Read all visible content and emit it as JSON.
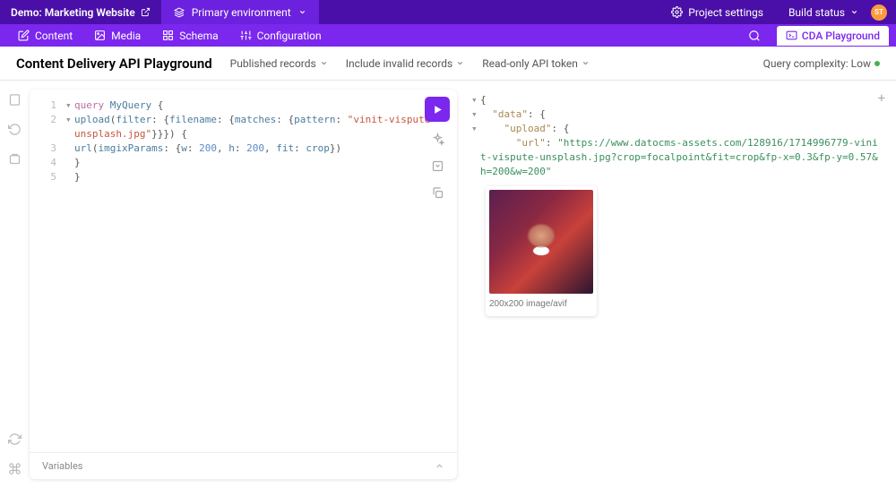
{
  "topbar": {
    "brand": "Demo: Marketing Website",
    "env_label": "Primary environment",
    "project_settings": "Project settings",
    "build_status": "Build status",
    "avatar_initials": "ST"
  },
  "navbar": {
    "content": "Content",
    "media": "Media",
    "schema": "Schema",
    "configuration": "Configuration",
    "cda_playground": "CDA Playground"
  },
  "header": {
    "title": "Content Delivery API Playground",
    "published_records": "Published records",
    "include_invalid": "Include invalid records",
    "readonly_token": "Read-only API token",
    "complexity_label": "Query complexity: Low"
  },
  "query": {
    "lines": [
      {
        "n": "1",
        "fold": "▾",
        "tokens": [
          {
            "c": "tok-kw",
            "t": "query"
          },
          {
            "c": "",
            "t": " "
          },
          {
            "c": "tok-name",
            "t": "MyQuery"
          },
          {
            "c": "",
            "t": " "
          },
          {
            "c": "tok-paren",
            "t": "{"
          }
        ]
      },
      {
        "n": "2",
        "fold": "▾",
        "indent": "  ",
        "tokens": [
          {
            "c": "tok-name",
            "t": "upload"
          },
          {
            "c": "tok-paren",
            "t": "("
          },
          {
            "c": "tok-attr",
            "t": "filter"
          },
          {
            "c": "tok-paren",
            "t": ": {"
          },
          {
            "c": "tok-attr",
            "t": "filename"
          },
          {
            "c": "tok-paren",
            "t": ": {"
          },
          {
            "c": "tok-attr",
            "t": "matches"
          },
          {
            "c": "tok-paren",
            "t": ": {"
          },
          {
            "c": "tok-attr",
            "t": "pattern"
          },
          {
            "c": "tok-paren",
            "t": ": "
          },
          {
            "c": "tok-str",
            "t": "\"vinit-vispute-unsplash.jpg\""
          },
          {
            "c": "tok-paren",
            "t": "}}}) {"
          }
        ]
      },
      {
        "n": "3",
        "fold": "",
        "indent": "    ",
        "tokens": [
          {
            "c": "tok-name",
            "t": "url"
          },
          {
            "c": "tok-paren",
            "t": "("
          },
          {
            "c": "tok-attr",
            "t": "imgixParams"
          },
          {
            "c": "tok-paren",
            "t": ": {"
          },
          {
            "c": "tok-attr",
            "t": "w"
          },
          {
            "c": "tok-paren",
            "t": ": "
          },
          {
            "c": "tok-num",
            "t": "200"
          },
          {
            "c": "tok-paren",
            "t": ", "
          },
          {
            "c": "tok-attr",
            "t": "h"
          },
          {
            "c": "tok-paren",
            "t": ": "
          },
          {
            "c": "tok-num",
            "t": "200"
          },
          {
            "c": "tok-paren",
            "t": ", "
          },
          {
            "c": "tok-attr",
            "t": "fit"
          },
          {
            "c": "tok-paren",
            "t": ": "
          },
          {
            "c": "tok-name",
            "t": "crop"
          },
          {
            "c": "tok-paren",
            "t": "})"
          }
        ]
      },
      {
        "n": "4",
        "fold": "",
        "indent": "  ",
        "tokens": [
          {
            "c": "tok-paren",
            "t": "}"
          }
        ]
      },
      {
        "n": "5",
        "fold": "",
        "tokens": [
          {
            "c": "tok-paren",
            "t": "}"
          }
        ]
      }
    ],
    "variables_label": "Variables"
  },
  "result": {
    "lines": [
      {
        "fold": "▾",
        "indent": "",
        "tokens": [
          {
            "c": "jp",
            "t": "{"
          }
        ]
      },
      {
        "fold": "▾",
        "indent": "  ",
        "tokens": [
          {
            "c": "jk",
            "t": "\"data\""
          },
          {
            "c": "jp",
            "t": ": {"
          }
        ]
      },
      {
        "fold": "▾",
        "indent": "    ",
        "tokens": [
          {
            "c": "jk",
            "t": "\"upload\""
          },
          {
            "c": "jp",
            "t": ": {"
          }
        ]
      },
      {
        "fold": "",
        "indent": "      ",
        "tokens": [
          {
            "c": "jk",
            "t": "\"url\""
          },
          {
            "c": "jp",
            "t": ": "
          },
          {
            "c": "jv-str",
            "t": "\"https://www.datocms-assets.com/128916/1714996779-vinit-vispute-unsplash.jpg?crop=focalpoint&fit=crop&fp-x=0.3&fp-y=0.57&h=200&w=200\""
          }
        ]
      }
    ],
    "image_caption": "200x200 image/avif"
  }
}
